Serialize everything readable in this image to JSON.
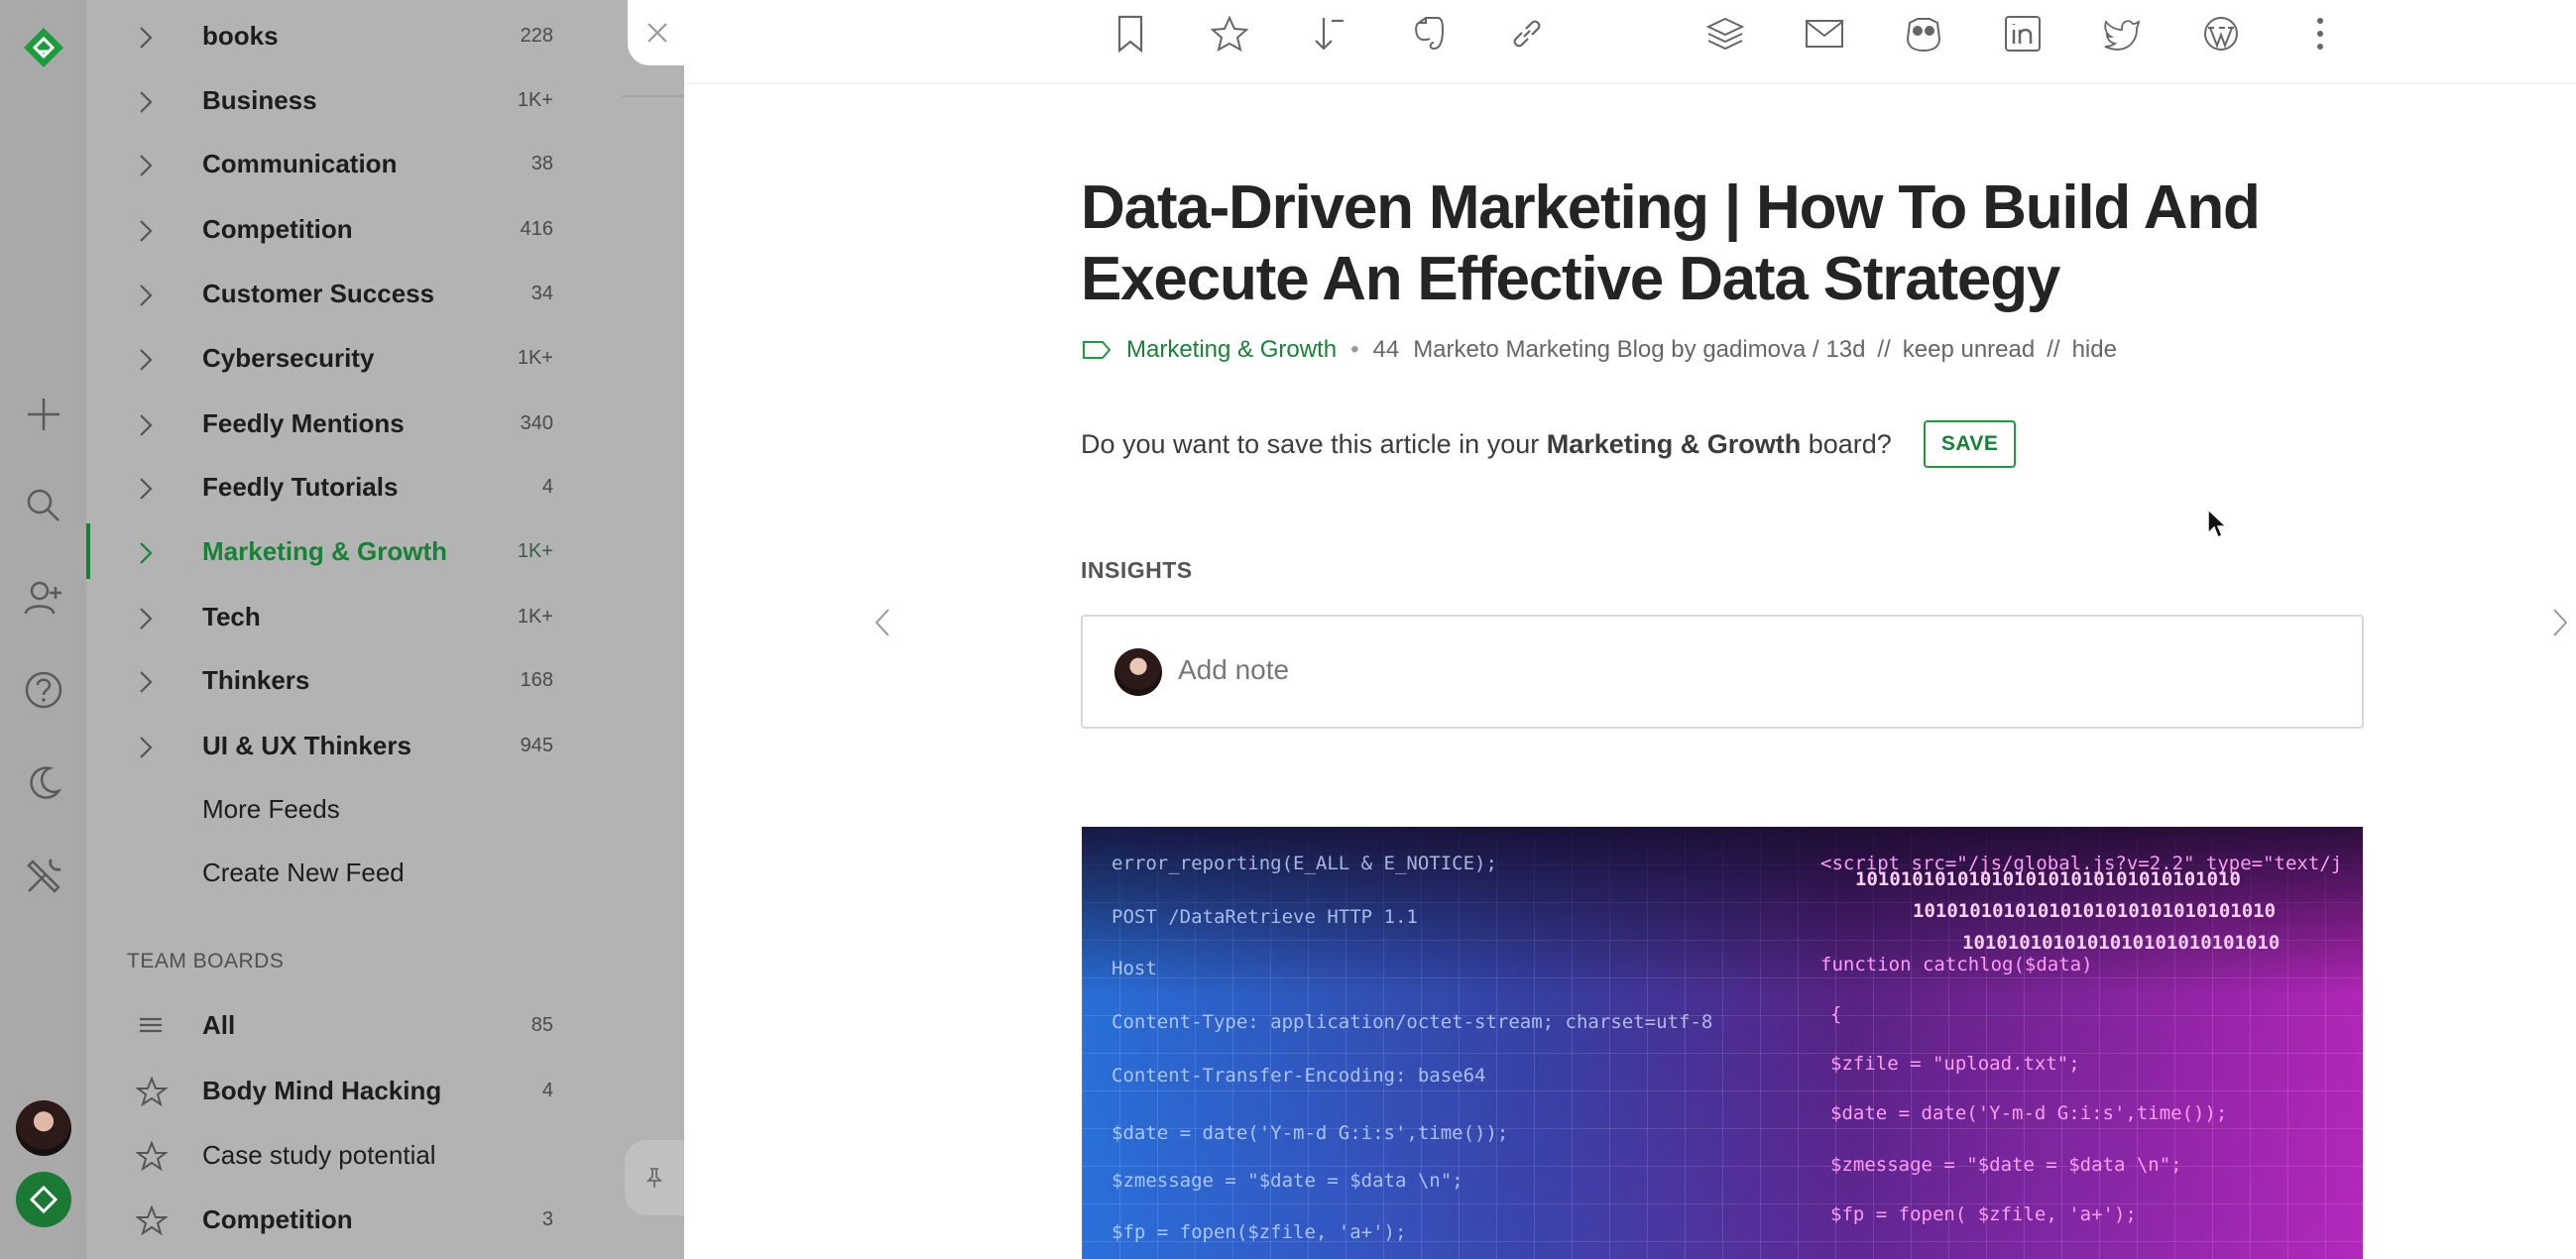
{
  "rail": {
    "icons": [
      "feedly-logo-icon",
      "plus-icon",
      "search-icon",
      "add-person-icon",
      "help-icon",
      "moon-icon",
      "tools-icon",
      "user-avatar",
      "feedly-avatar-icon"
    ]
  },
  "sidebar": {
    "feeds": [
      {
        "name": "books",
        "count": "228"
      },
      {
        "name": "Business",
        "count": "1K+"
      },
      {
        "name": "Communication",
        "count": "38"
      },
      {
        "name": "Competition",
        "count": "416"
      },
      {
        "name": "Customer Success",
        "count": "34"
      },
      {
        "name": "Cybersecurity",
        "count": "1K+"
      },
      {
        "name": "Feedly Mentions",
        "count": "340"
      },
      {
        "name": "Feedly Tutorials",
        "count": "4"
      },
      {
        "name": "Marketing & Growth",
        "count": "1K+",
        "active": true
      },
      {
        "name": "Tech",
        "count": "1K+"
      },
      {
        "name": "Thinkers",
        "count": "168"
      },
      {
        "name": "UI & UX Thinkers",
        "count": "945"
      }
    ],
    "more_feeds": "More Feeds",
    "create_feed": "Create New Feed",
    "team_boards_title": "TEAM BOARDS",
    "boards": [
      {
        "name": "All",
        "count": "85",
        "icon": "list-icon"
      },
      {
        "name": "Body Mind Hacking",
        "count": "4",
        "icon": "star-icon"
      },
      {
        "name": "Case study potential",
        "count": "",
        "icon": "star-icon"
      },
      {
        "name": "Competition",
        "count": "3",
        "icon": "star-icon"
      }
    ]
  },
  "toolbar": {
    "icons": [
      "bookmark-icon",
      "star-icon",
      "mark-read-below-icon",
      "evernote-icon",
      "link-icon",
      "buffer-icon",
      "email-icon",
      "hootsuite-icon",
      "linkedin-icon",
      "twitter-icon",
      "wordpress-icon",
      "more-icon"
    ]
  },
  "article": {
    "title": "Data-Driven Marketing | How To Build And Execute An Effective Data Strategy",
    "category": "Marketing & Growth",
    "engagement": "44",
    "source": "Marketo Marketing Blog by gadimova / 13d",
    "sep1": "//",
    "keep_unread": "keep unread",
    "sep2": "//",
    "hide": "hide",
    "save_prompt_pre": "Do you want to save this article in your ",
    "save_prompt_board": "Marketing & Growth",
    "save_prompt_post": " board?",
    "save_label": "SAVE",
    "insights_title": "INSIGHTS",
    "note_placeholder": "Add note"
  },
  "hero_code": {
    "left": [
      "error_reporting(E_ALL & E_NOTICE);",
      "POST /DataRetrieve HTTP 1.1",
      "Host",
      "Content-Type: application/octet-stream; charset=utf-8",
      "Content-Transfer-Encoding: base64",
      "$date = date('Y-m-d G:i:s',time());",
      "$zmessage = \"$date = $data \\n\";",
      "$fp = fopen($zfile, 'a+');"
    ],
    "right": [
      "<script src=\"/js/global.js?v=2.2\" type=\"text/j",
      "function catchlog($data)",
      "{",
      "$zfile = \"upload.txt\";",
      "$date = date('Y-m-d G:i:s',time());",
      "$zmessage = \"$date = $data \\n\";",
      "$fp = fopen( $zfile, 'a+');"
    ],
    "binary": [
      "1010101010101010101010101010101010",
      "10101010101010101010101010101010",
      "1010101010101010101010101010"
    ]
  }
}
